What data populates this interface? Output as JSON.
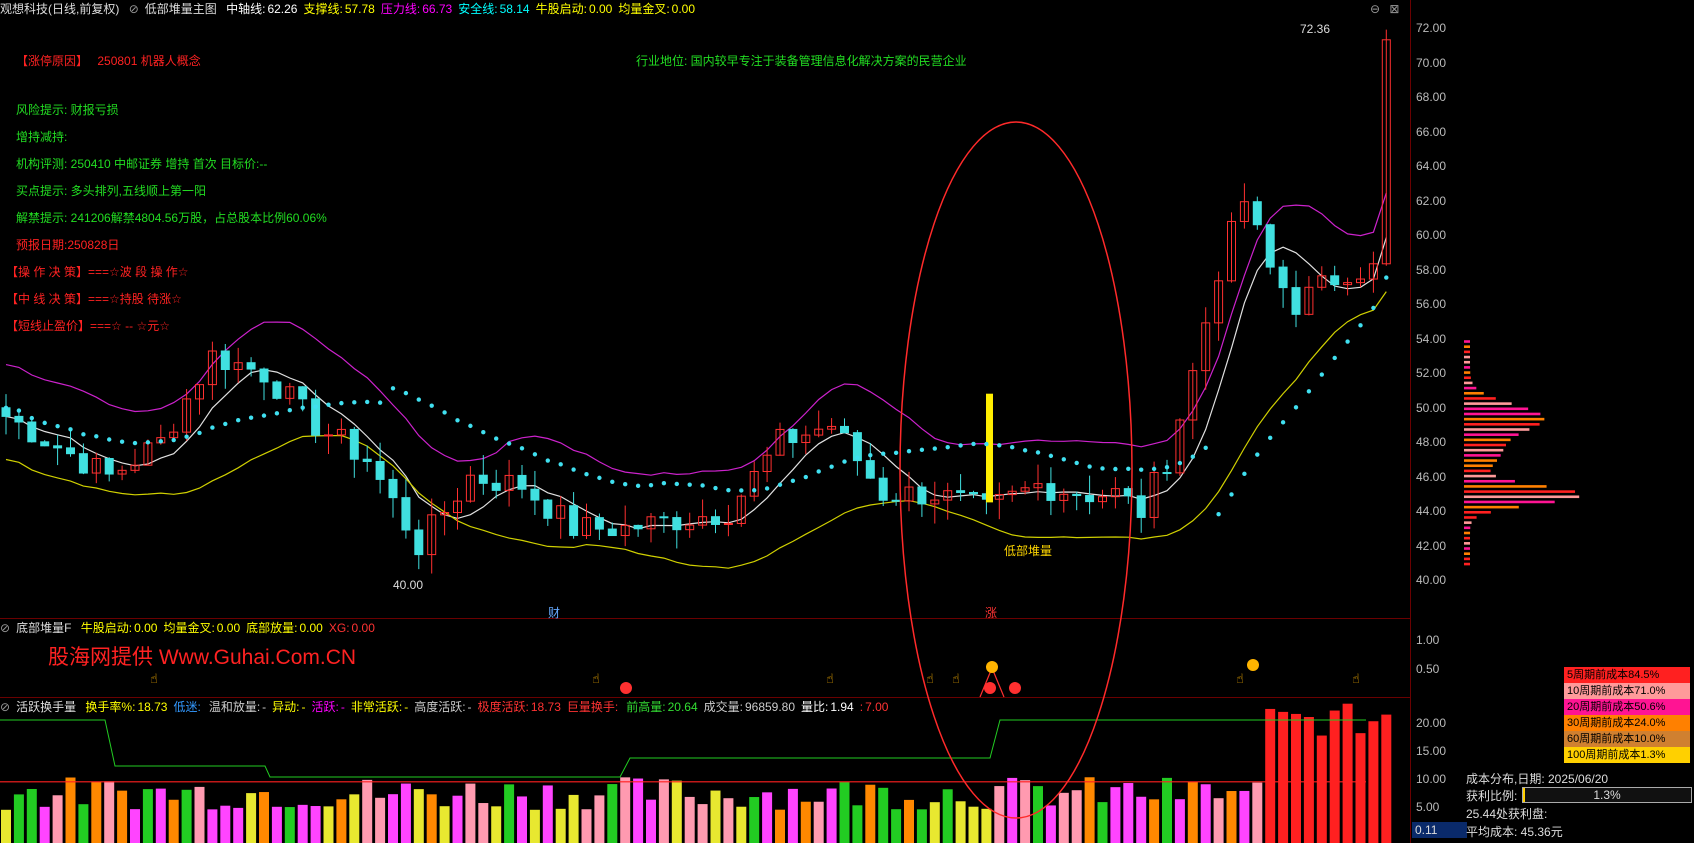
{
  "header": {
    "app": "观想科技",
    "period": "(日线,前复权)",
    "indicator": "低部堆量主图",
    "items": [
      {
        "label": "中轴线:",
        "value": "62.26",
        "color": "#ffffff"
      },
      {
        "label": "支撑线:",
        "value": "57.78",
        "color": "#ffff00"
      },
      {
        "label": "压力线:",
        "value": "66.73",
        "color": "#ff00ff"
      },
      {
        "label": "安全线:",
        "value": "58.14",
        "color": "#00ffff"
      },
      {
        "label": "牛股启动:",
        "value": "0.00",
        "color": "#ffff00"
      },
      {
        "label": "均量金叉:",
        "value": "0.00",
        "color": "#ffff00"
      }
    ]
  },
  "annotations": {
    "reason_label": "【涨停原因】",
    "reason_text": "250801 机器人概念",
    "industry": "行业地位: 国内较早专注于装备管理信息化解决方案的民营企业",
    "lines": [
      {
        "text": "风险提示: 财报亏损",
        "color": "#22dd22"
      },
      {
        "text": "增持减持:",
        "color": "#22dd22"
      },
      {
        "text": "机构评测: 250410 中邮证券 增持 首次 目标价:--",
        "color": "#22dd22"
      },
      {
        "text": "买点提示: 多头排列,五线顺上第一阳",
        "color": "#22dd22"
      },
      {
        "text": "解禁提示: 241206解禁4804.56万股，占总股本比例60.06%",
        "color": "#22dd22"
      },
      {
        "text": "预报日期:250828日",
        "color": "#ff2222"
      },
      {
        "text": "【操 作 决 策】===☆波 段 操 作☆",
        "color": "#ff2222"
      },
      {
        "text": "【中 线 决 策】===☆持股 待涨☆",
        "color": "#ff2222"
      },
      {
        "text": "【短线止盈价】===☆  --  ☆元☆",
        "color": "#ff2222"
      }
    ],
    "high_label": "72.36",
    "low_label": "40.00",
    "bottom_label": "低部堆量",
    "cai_tag": "财",
    "zhang_tag": "涨"
  },
  "price_axis": [
    "72.00",
    "70.00",
    "68.00",
    "66.00",
    "64.00",
    "62.00",
    "60.00",
    "58.00",
    "56.00",
    "54.00",
    "52.00",
    "50.00",
    "48.00",
    "46.00",
    "44.00",
    "42.00",
    "40.00"
  ],
  "mid_panel": {
    "name": "底部堆量F",
    "items": [
      {
        "label": "牛股启动:",
        "value": "0.00",
        "color": "#ffff00"
      },
      {
        "label": "均量金叉:",
        "value": "0.00",
        "color": "#ffff00"
      },
      {
        "label": "底部放量:",
        "value": "0.00",
        "color": "#ffff00"
      },
      {
        "label": "XG:",
        "value": "0.00",
        "color": "#ff3333"
      }
    ],
    "watermark": "股海网提供 Www.Guhai.Com.CN",
    "axis": [
      "1.00",
      "0.50"
    ]
  },
  "low_panel": {
    "name": "活跃换手量",
    "items": [
      {
        "label": "换手率%:",
        "value": "18.73",
        "color": "#ffff00"
      },
      {
        "label": "低迷:",
        "value": "",
        "color": "#3399ff"
      },
      {
        "label": "温和放量:",
        "value": "-",
        "color": "#cccccc"
      },
      {
        "label": "异动:",
        "value": "-",
        "color": "#ffff00"
      },
      {
        "label": "活跃:",
        "value": "-",
        "color": "#ff00ff"
      },
      {
        "label": "非常活跃:",
        "value": "-",
        "color": "#ffff00"
      },
      {
        "label": "高度活跃:",
        "value": "-",
        "color": "#cccccc"
      },
      {
        "label": "极度活跃:",
        "value": "18.73",
        "color": "#ff3333"
      },
      {
        "label": "巨量换手:",
        "value": "",
        "color": "#ff3333"
      },
      {
        "label": "前高量:",
        "value": "20.64",
        "color": "#33dd33"
      },
      {
        "label": "成交量:",
        "value": "96859.80",
        "color": "#cccccc"
      },
      {
        "label": "量比:",
        "value": "1.94",
        "color": "#ffffff"
      },
      {
        "label": ":",
        "value": "7.00",
        "color": "#ff3333"
      }
    ],
    "axis": [
      "20.00",
      "15.00",
      "10.00",
      "5.00"
    ],
    "corner": "0.11"
  },
  "chip_legend": [
    {
      "text": "5周期前成本84.5%",
      "color": "#ff2020"
    },
    {
      "text": "10周期前成本71.0%",
      "color": "#ff9a9a"
    },
    {
      "text": "20周期前成本50.6%",
      "color": "#ff1493"
    },
    {
      "text": "30周期前成本24.0%",
      "color": "#ff8000"
    },
    {
      "text": "60周期前成本10.0%",
      "color": "#d08030"
    },
    {
      "text": "100周期前成本1.3%",
      "color": "#ffd000"
    }
  ],
  "chip_info": {
    "date_line": "成本分布,日期:  2025/06/20",
    "profit_label": "获利比例:",
    "profit_value": "1.3%",
    "profit_ratio": 0.013,
    "profit_line": "25.44处获利盘:",
    "avg_line": "平均成本:  45.36元"
  }
}
